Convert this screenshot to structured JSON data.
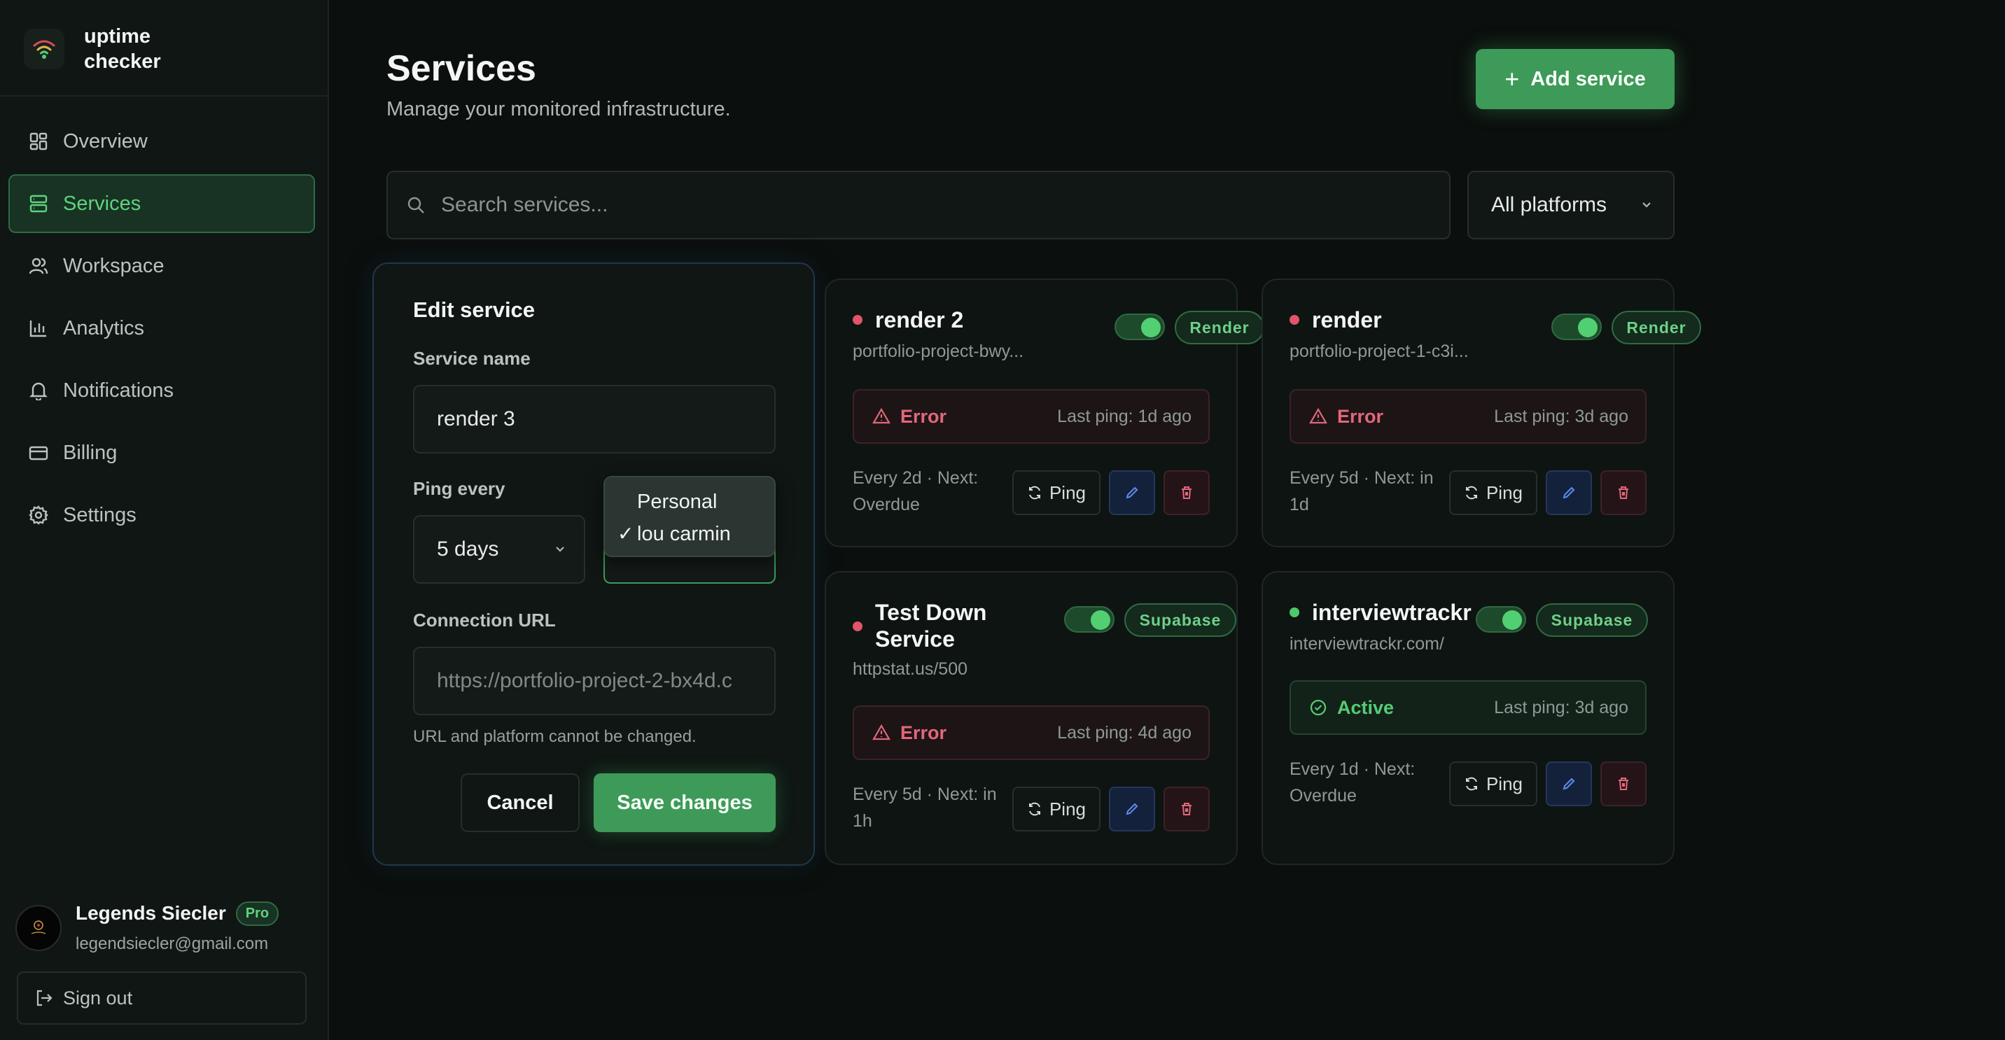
{
  "app": {
    "name": "uptime checker"
  },
  "sidebar": {
    "items": [
      {
        "label": "Overview",
        "icon": "grid-icon",
        "active": false
      },
      {
        "label": "Services",
        "icon": "server-icon",
        "active": true
      },
      {
        "label": "Workspace",
        "icon": "users-icon",
        "active": false
      },
      {
        "label": "Analytics",
        "icon": "bar-chart-icon",
        "active": false
      },
      {
        "label": "Notifications",
        "icon": "bell-icon",
        "active": false
      },
      {
        "label": "Billing",
        "icon": "credit-card-icon",
        "active": false
      },
      {
        "label": "Settings",
        "icon": "gear-icon",
        "active": false
      }
    ],
    "user": {
      "name": "Legends Siecler",
      "plan": "Pro",
      "email": "legendsiecler@gmail.com"
    },
    "sign_out": "Sign out"
  },
  "header": {
    "title": "Services",
    "subtitle": "Manage your monitored infrastructure.",
    "add_button": "Add service"
  },
  "filters": {
    "search_placeholder": "Search services...",
    "platform": "All platforms"
  },
  "edit_panel": {
    "title": "Edit service",
    "name_label": "Service name",
    "name_value": "render 3",
    "ping_label": "Ping every",
    "ping_value": "5 days",
    "workspace_options": [
      "Personal",
      "lou carmin"
    ],
    "workspace_selected": "lou carmin",
    "url_label": "Connection URL",
    "url_value": "https://portfolio-project-2-bx4d.c",
    "note": "URL and platform cannot be changed.",
    "cancel": "Cancel",
    "save": "Save changes"
  },
  "services": [
    {
      "name": "render 2",
      "url": "portfolio-project-bwy...",
      "platform": "Render",
      "enabled": true,
      "status": "Error",
      "last_ping": "Last ping: 1d ago",
      "schedule": "Every 2d · Next: Overdue",
      "ping_label": "Ping"
    },
    {
      "name": "render",
      "url": "portfolio-project-1-c3i...",
      "platform": "Render",
      "enabled": true,
      "status": "Error",
      "last_ping": "Last ping: 3d ago",
      "schedule": "Every 5d · Next: in 1d",
      "ping_label": "Ping"
    },
    {
      "name": "Test Down Service",
      "url": "httpstat.us/500",
      "platform": "Supabase",
      "enabled": true,
      "status": "Error",
      "last_ping": "Last ping: 4d ago",
      "schedule": "Every 5d · Next: in 1h",
      "ping_label": "Ping"
    },
    {
      "name": "interviewtrackr",
      "url": "interviewtrackr.com/",
      "platform": "Supabase",
      "enabled": true,
      "status": "Active",
      "last_ping": "Last ping: 3d ago",
      "schedule": "Every 1d · Next: Overdue",
      "ping_label": "Ping"
    }
  ],
  "colors": {
    "accent": "#3e9a58",
    "error": "#e25469",
    "active": "#4fc96d",
    "background": "#0b0f0d"
  }
}
